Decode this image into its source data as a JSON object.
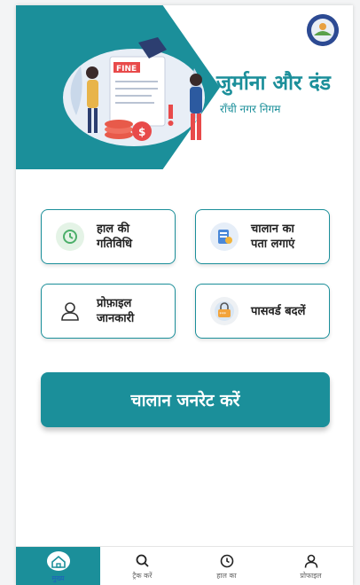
{
  "header": {
    "title": "जुर्माना और दंड",
    "subtitle": "राँची नगर निगम",
    "illustration_text": "FINE"
  },
  "tiles": [
    {
      "label_line1": "हाल की",
      "label_line2": "गतिविधि",
      "icon": "history-icon"
    },
    {
      "label_line1": "चालान का",
      "label_line2": "पता लगाएं",
      "icon": "document-search-icon"
    },
    {
      "label_line1": "प्रोफ़ाइल",
      "label_line2": "जानकारी",
      "icon": "user-icon"
    },
    {
      "label_line1": "पासवर्ड बदलें",
      "label_line2": "",
      "icon": "password-lock-icon"
    }
  ],
  "primary_button": {
    "label": "चालान जनरेट करें"
  },
  "bottom_nav": [
    {
      "label": "मुख्य",
      "icon": "home-icon",
      "active": true
    },
    {
      "label": "ट्रैक करें",
      "icon": "search-icon",
      "active": false
    },
    {
      "label": "हाल का",
      "icon": "history-icon",
      "active": false
    },
    {
      "label": "प्रोफाइल",
      "icon": "user-icon",
      "active": false
    }
  ],
  "colors": {
    "accent": "#1b8f9a",
    "active_nav_label": "#1e5fbf"
  }
}
